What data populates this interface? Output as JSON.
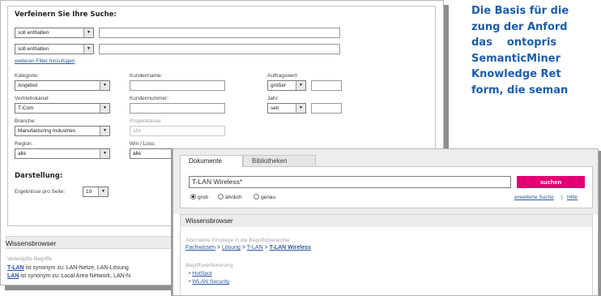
{
  "refine": {
    "title": "Verfeinern Sie Ihre Suche:",
    "filters": [
      {
        "operator": "soll enthalten",
        "value": ""
      },
      {
        "operator": "soll enthalten",
        "value": ""
      }
    ],
    "more_filters_link": "weiteren Filter hinzufügen",
    "fields": {
      "kategorie": {
        "label": "Kategorie:",
        "value": "Angebot"
      },
      "kundenname": {
        "label": "Kundenname:",
        "value": ""
      },
      "auftragswert": {
        "label": "Auftragswert:",
        "operator": "größer",
        "value": ""
      },
      "vertriebskanal": {
        "label": "Vertriebskanal:",
        "value": "T-Com"
      },
      "kundennummer": {
        "label": "Kundennummer:",
        "value": ""
      },
      "jahr": {
        "label": "Jahr:",
        "operator": "seit",
        "value": ""
      },
      "branche": {
        "label": "Branche:",
        "value": "Manufacturing Industries"
      },
      "projektklasse": {
        "label": "Projektklasse:",
        "value": "alle"
      },
      "region": {
        "label": "Region:",
        "value": "alle"
      },
      "winloss": {
        "label": "Win / Loss:",
        "value": "alle"
      }
    },
    "display": {
      "title": "Darstellung:",
      "per_page_label": "Ergebnisse pro Seite:",
      "per_page_value": "10"
    }
  },
  "wissensbrowser_back": {
    "title": "Wissensbrowser",
    "related_terms_label": "Verknüpfte Begriffe",
    "synonyms": [
      {
        "term": "T-LAN",
        "text": " ist synonym zu: LAN-Netze, LAN-Lösung"
      },
      {
        "term": "LAN",
        "text": " ist synonym zu: Local Area Network, LAN-N"
      }
    ]
  },
  "search": {
    "tabs": [
      "Dokumente",
      "Bibliotheken"
    ],
    "query": "T-LAN Wireless*",
    "button_label": "suchen",
    "modes": [
      {
        "label": "grob",
        "selected": true
      },
      {
        "label": "ähnlich",
        "selected": false
      },
      {
        "label": "genau",
        "selected": false
      }
    ],
    "advanced_link": "erweiterte Suche",
    "separator": "|",
    "help_link": "Hilfe",
    "accent_color": "#e20074"
  },
  "wissensbrowser_front": {
    "title": "Wissensbrowser",
    "hierarchy_label": "Alternative Einstiege in die Begriffshierarchie",
    "breadcrumb": [
      "Fachwissen",
      "Lösung",
      "T-LAN",
      "T-LAN Wireless"
    ],
    "breadcrumb_sep": " > ",
    "refinement_label": "Begriffsverfeinerung",
    "refinements": [
      "HotSpot",
      "WLAN Security"
    ]
  },
  "article": {
    "lines": [
      "Die Basis für die",
      "zung der Anford",
      "das    ontopris",
      "SemanticMiner",
      "Knowledge Ret",
      "form, die seman"
    ]
  }
}
